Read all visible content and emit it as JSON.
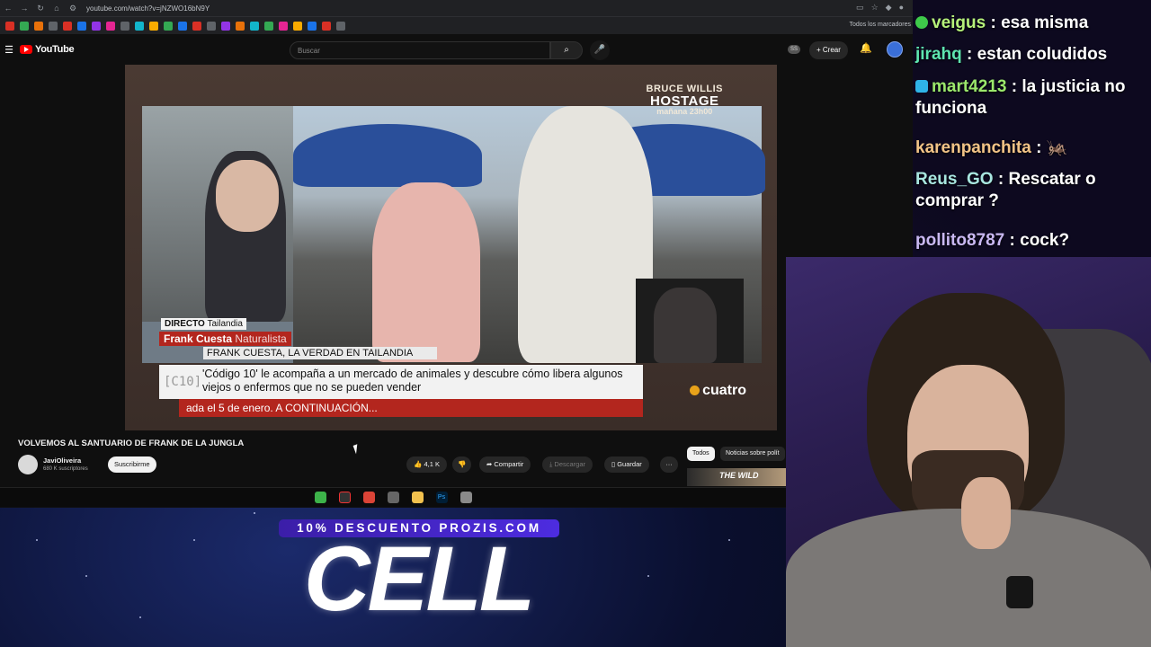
{
  "browser": {
    "url": "youtube.com/watch?v=jNZWO16bN9Y",
    "all_bookmarks_label": "Todos los marcadores"
  },
  "youtube": {
    "logo_text": "YouTube",
    "search_placeholder": "Buscar",
    "ss_badge": "SS",
    "create_label": "Crear",
    "video": {
      "brand_line1": "BRUCE WILLIS",
      "brand_line2": "HOSTAGE",
      "brand_line3": "mañana 23h00",
      "live_label": "DIRECTO",
      "live_location": "Tailandia",
      "person_name": "Frank Cuesta",
      "person_role": "Naturalista",
      "headline": "FRANK CUESTA, LA VERDAD EN TAILANDIA",
      "show_logo": "[C10]",
      "description": "'Código 10' le acompaña a un mercado de animales y descubre cómo libera algunos viejos o enfermos que no se pueden vender",
      "ticker": "ada el 5 de enero. A CONTINUACIÓN...",
      "channel_logo": "cuatro"
    },
    "title": "VOLVEMOS AL SANTUARIO DE FRANK DE LA JUNGLA",
    "channel": {
      "name": "JaviOliveira",
      "subscribers": "680 K suscriptores",
      "subscribe_label": "Suscribirme"
    },
    "actions": {
      "likes": "4,1 K",
      "share": "Compartir",
      "download": "Descargar",
      "save": "Guardar",
      "more": "···"
    },
    "chips": [
      "Todos",
      "Noticias sobre polít"
    ],
    "thumb_text": "THE WILD"
  },
  "chat": [
    {
      "user": "veigus",
      "text": " : esa misma",
      "color": "#b6f27a",
      "badge": "#3ec94a"
    },
    {
      "user": "jirahq",
      "text": " : estan coludidos",
      "color": "#5ee6b0",
      "badge": ""
    },
    {
      "user": "mart4213",
      "text": " : la justicia no funciona",
      "color": "#9be86c",
      "badge": "#2fb4e8"
    },
    {
      "user": "karenpanchita",
      "text": " : 🦗",
      "color": "#f2c487",
      "badge": ""
    },
    {
      "user": "Reus_GO",
      "text": " : Rescatar o comprar ?",
      "color": "#a8e6e0",
      "badge": ""
    },
    {
      "user": "pollito8787",
      "text": " : cock?",
      "color": "#c9b8f2",
      "badge": ""
    }
  ],
  "sponsor": {
    "promo": "10% DESCUENTO PROZIS.COM",
    "headline": "CELL"
  }
}
